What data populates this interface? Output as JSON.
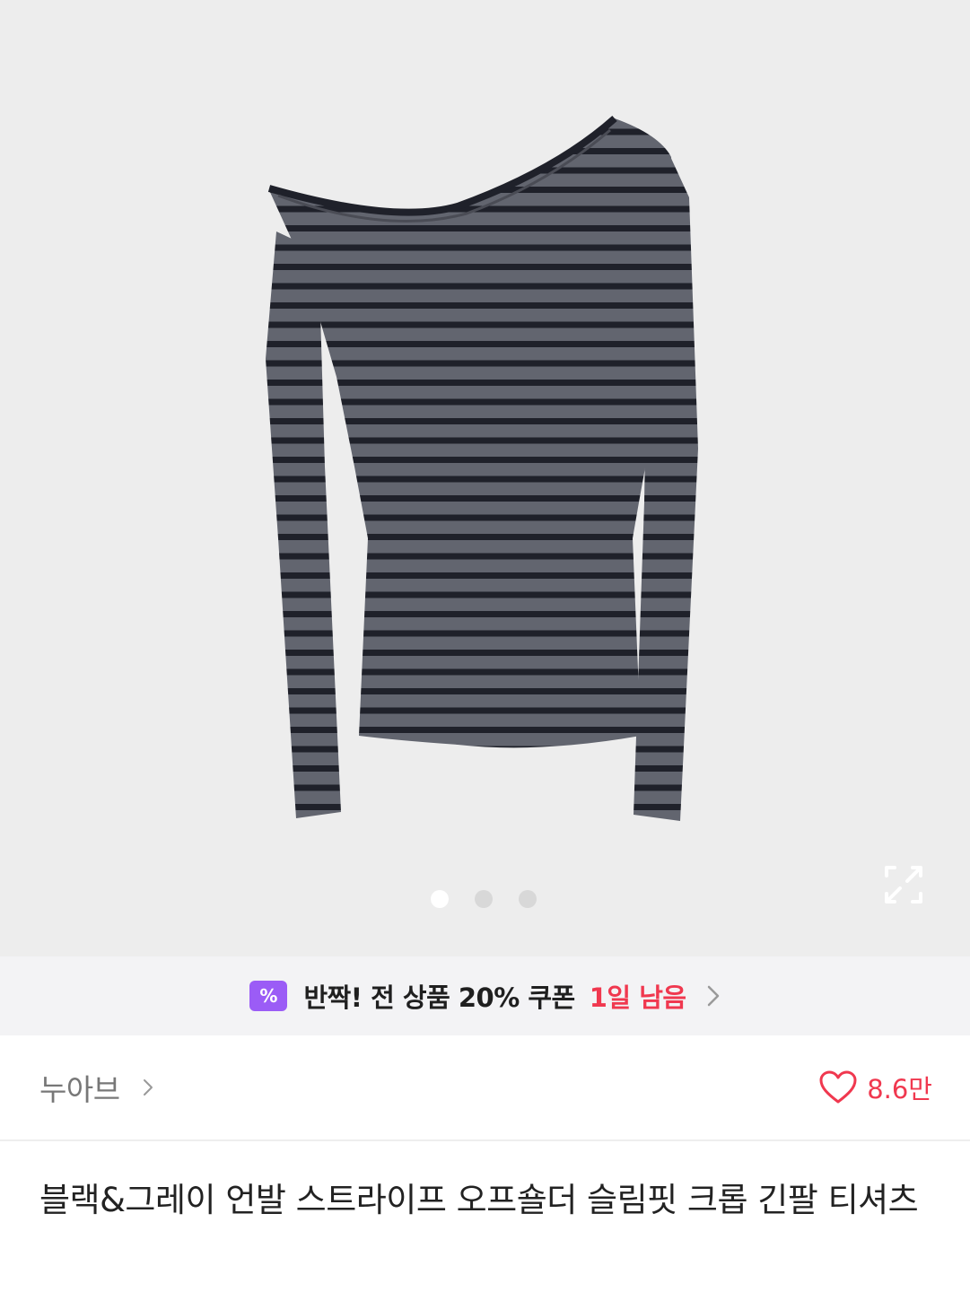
{
  "gallery": {
    "image_alt": "블랙&그레이 언발 스트라이프 오프숄더 슬림핏 크롭 긴팔 티셔츠",
    "current_index": 1,
    "total_images": 3,
    "expand_icon": "expand-icon"
  },
  "coupon": {
    "icon": "coupon-percent-icon",
    "icon_symbol": "%",
    "text": "반짝! 전 상품 20% 쿠폰",
    "remaining": "1일 남음",
    "accent_color": "#f0384f",
    "icon_color": "#9b5cf6"
  },
  "brand": {
    "name": "누아브",
    "like_count": "8.6만"
  },
  "product": {
    "title": "블랙&그레이 언발 스트라이프 오프숄더 슬림핏 크롭 긴팔 티셔츠"
  }
}
